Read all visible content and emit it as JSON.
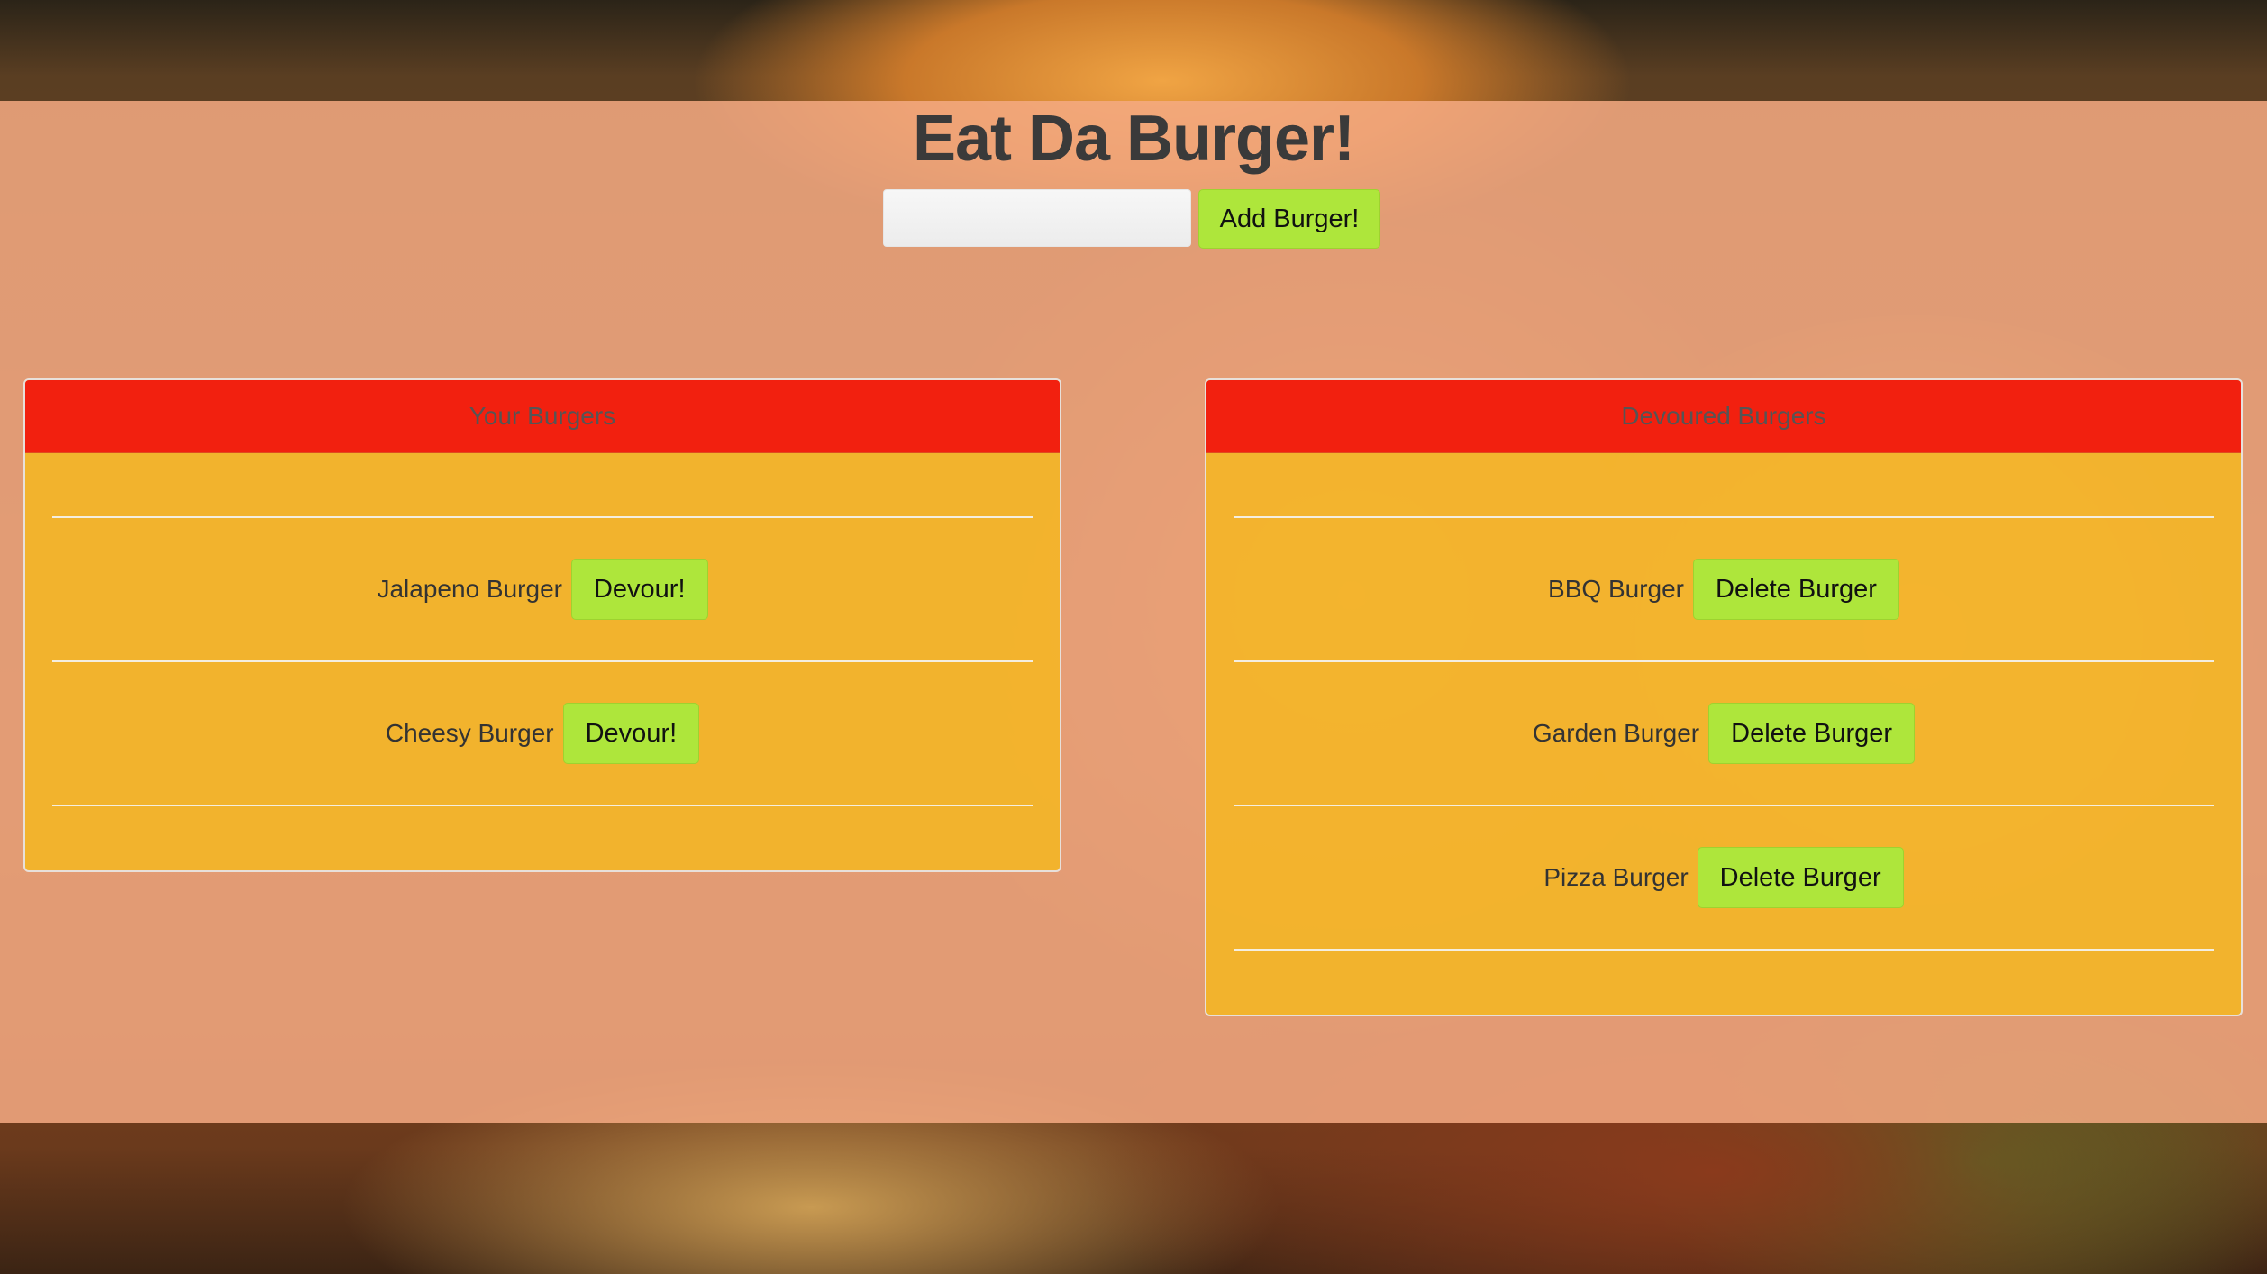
{
  "header": {
    "title": "Eat Da Burger!",
    "input_placeholder": "",
    "add_label": "Add Burger!"
  },
  "panels": {
    "uneaten": {
      "heading": "Your Burgers",
      "action_label": "Devour!",
      "items": [
        "Jalapeno Burger",
        "Cheesy Burger"
      ]
    },
    "devoured": {
      "heading": "Devoured Burgers",
      "action_label": "Delete Burger",
      "items": [
        "BBQ Burger",
        "Garden Burger",
        "Pizza Burger"
      ]
    }
  },
  "colors": {
    "overlay": "#f4aa82",
    "panel_heading": "#f2200f",
    "panel_body": "#f5b722",
    "button": "#aee63b"
  }
}
